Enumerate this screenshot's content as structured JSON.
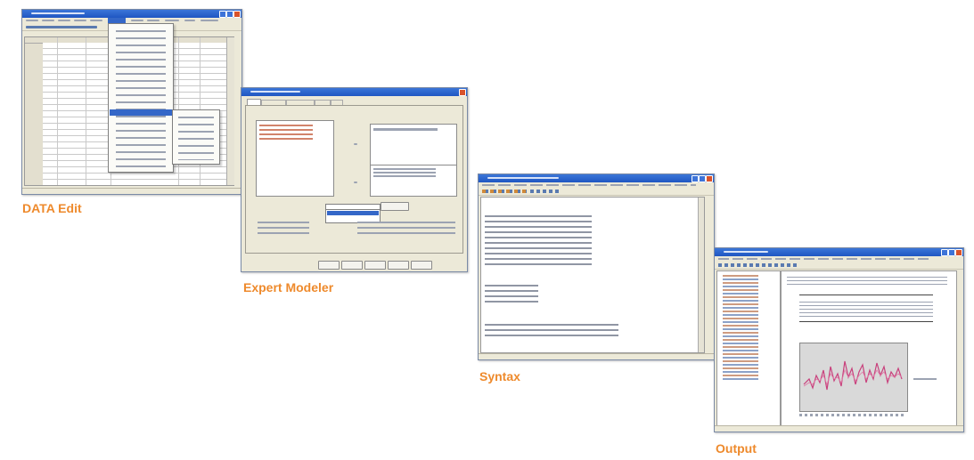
{
  "screenshots": [
    {
      "id": "data-edit",
      "caption": "DATA Edit"
    },
    {
      "id": "expert-modeler",
      "caption": "Expert Modeler"
    },
    {
      "id": "syntax",
      "caption": "Syntax"
    },
    {
      "id": "output",
      "caption": "Output"
    }
  ],
  "colors": {
    "caption": "#ee8a2c",
    "titlebar": "#2a62cc",
    "window_chrome": "#ece9d8",
    "selection": "#3467c8",
    "chart_line": "#c8407c"
  }
}
